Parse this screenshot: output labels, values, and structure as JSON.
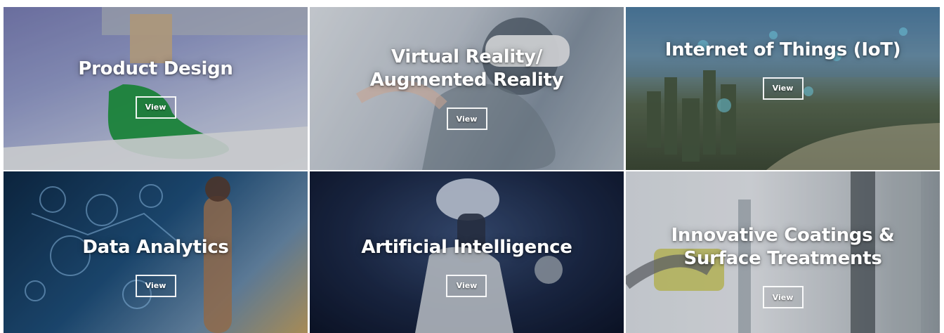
{
  "tiles": [
    {
      "title": "Product Design",
      "button": "View"
    },
    {
      "title": "Virtual Reality/ Augmented Reality",
      "button": "View"
    },
    {
      "title": "Internet of Things (IoT)",
      "button": "View"
    },
    {
      "title": "Data Analytics",
      "button": "View"
    },
    {
      "title": "Artificial Intelligence",
      "button": "View"
    },
    {
      "title": "Innovative Coatings & Surface Treatments",
      "button": "View"
    }
  ]
}
